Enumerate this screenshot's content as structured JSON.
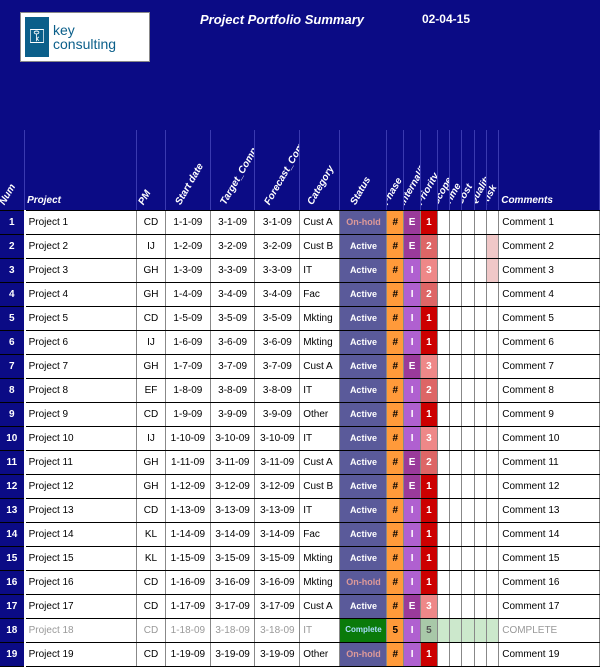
{
  "header": {
    "logo_text": "key\nconsulting",
    "title": "Project Portfolio Summary",
    "asof": "02-04-15"
  },
  "columns": [
    "Num",
    "Project",
    "PM",
    "Start date",
    "Target_Comp_Date",
    "Forecast_Comp_Date",
    "Category",
    "Status",
    "Phase",
    "Internal/Exter",
    "Priority",
    "Scope",
    "Time",
    "Cost",
    "Quality",
    "Risk",
    "Comments"
  ],
  "status_labels": {
    "Active": "Active",
    "Onhold": "On-hold",
    "Complete": "Complete"
  },
  "rows": [
    {
      "num": 1,
      "project": "Project 1",
      "pm": "CD",
      "start": "1-1-09",
      "target": "3-1-09",
      "forecast": "3-1-09",
      "cat": "Cust A",
      "status": "Onhold",
      "phase": "#",
      "ie": "E",
      "pri": 1,
      "mini": [
        "",
        "",
        "",
        "",
        ""
      ],
      "comment": "Comment 1"
    },
    {
      "num": 2,
      "project": "Project 2",
      "pm": "IJ",
      "start": "1-2-09",
      "target": "3-2-09",
      "forecast": "3-2-09",
      "cat": "Cust B",
      "status": "Active",
      "phase": "#",
      "ie": "E",
      "pri": 2,
      "mini": [
        "",
        "",
        "",
        "",
        "p"
      ],
      "comment": "Comment 2"
    },
    {
      "num": 3,
      "project": "Project 3",
      "pm": "GH",
      "start": "1-3-09",
      "target": "3-3-09",
      "forecast": "3-3-09",
      "cat": "IT",
      "status": "Active",
      "phase": "#",
      "ie": "I",
      "pri": 3,
      "mini": [
        "",
        "",
        "",
        "",
        "p"
      ],
      "comment": "Comment 3"
    },
    {
      "num": 4,
      "project": "Project 4",
      "pm": "GH",
      "start": "1-4-09",
      "target": "3-4-09",
      "forecast": "3-4-09",
      "cat": "Fac",
      "status": "Active",
      "phase": "#",
      "ie": "I",
      "pri": 2,
      "mini": [
        "",
        "",
        "",
        "",
        ""
      ],
      "comment": "Comment 4"
    },
    {
      "num": 5,
      "project": "Project 5",
      "pm": "CD",
      "start": "1-5-09",
      "target": "3-5-09",
      "forecast": "3-5-09",
      "cat": "Mkting",
      "status": "Active",
      "phase": "#",
      "ie": "I",
      "pri": 1,
      "mini": [
        "",
        "",
        "",
        "",
        ""
      ],
      "comment": "Comment 5"
    },
    {
      "num": 6,
      "project": "Project 6",
      "pm": "IJ",
      "start": "1-6-09",
      "target": "3-6-09",
      "forecast": "3-6-09",
      "cat": "Mkting",
      "status": "Active",
      "phase": "#",
      "ie": "I",
      "pri": 1,
      "mini": [
        "",
        "",
        "",
        "",
        ""
      ],
      "comment": "Comment 6"
    },
    {
      "num": 7,
      "project": "Project 7",
      "pm": "GH",
      "start": "1-7-09",
      "target": "3-7-09",
      "forecast": "3-7-09",
      "cat": "Cust A",
      "status": "Active",
      "phase": "#",
      "ie": "E",
      "pri": 3,
      "mini": [
        "",
        "",
        "",
        "",
        ""
      ],
      "comment": "Comment 7"
    },
    {
      "num": 8,
      "project": "Project 8",
      "pm": "EF",
      "start": "1-8-09",
      "target": "3-8-09",
      "forecast": "3-8-09",
      "cat": "IT",
      "status": "Active",
      "phase": "#",
      "ie": "I",
      "pri": 2,
      "mini": [
        "",
        "",
        "",
        "",
        ""
      ],
      "comment": "Comment 8"
    },
    {
      "num": 9,
      "project": "Project 9",
      "pm": "CD",
      "start": "1-9-09",
      "target": "3-9-09",
      "forecast": "3-9-09",
      "cat": "Other",
      "status": "Active",
      "phase": "#",
      "ie": "I",
      "pri": 1,
      "mini": [
        "",
        "",
        "",
        "",
        ""
      ],
      "comment": "Comment 9"
    },
    {
      "num": 10,
      "project": "Project 10",
      "pm": "IJ",
      "start": "1-10-09",
      "target": "3-10-09",
      "forecast": "3-10-09",
      "cat": "IT",
      "status": "Active",
      "phase": "#",
      "ie": "I",
      "pri": 3,
      "mini": [
        "",
        "",
        "",
        "",
        ""
      ],
      "comment": "Comment 10"
    },
    {
      "num": 11,
      "project": "Project 11",
      "pm": "GH",
      "start": "1-11-09",
      "target": "3-11-09",
      "forecast": "3-11-09",
      "cat": "Cust A",
      "status": "Active",
      "phase": "#",
      "ie": "E",
      "pri": 2,
      "mini": [
        "",
        "",
        "",
        "",
        ""
      ],
      "comment": "Comment 11"
    },
    {
      "num": 12,
      "project": "Project 12",
      "pm": "GH",
      "start": "1-12-09",
      "target": "3-12-09",
      "forecast": "3-12-09",
      "cat": "Cust B",
      "status": "Active",
      "phase": "#",
      "ie": "E",
      "pri": 1,
      "mini": [
        "",
        "",
        "",
        "",
        ""
      ],
      "comment": "Comment 12"
    },
    {
      "num": 13,
      "project": "Project 13",
      "pm": "CD",
      "start": "1-13-09",
      "target": "3-13-09",
      "forecast": "3-13-09",
      "cat": "IT",
      "status": "Active",
      "phase": "#",
      "ie": "I",
      "pri": 1,
      "mini": [
        "",
        "",
        "",
        "",
        ""
      ],
      "comment": "Comment 13"
    },
    {
      "num": 14,
      "project": "Project 14",
      "pm": "KL",
      "start": "1-14-09",
      "target": "3-14-09",
      "forecast": "3-14-09",
      "cat": "Fac",
      "status": "Active",
      "phase": "#",
      "ie": "I",
      "pri": 1,
      "mini": [
        "",
        "",
        "",
        "",
        ""
      ],
      "comment": "Comment 14"
    },
    {
      "num": 15,
      "project": "Project 15",
      "pm": "KL",
      "start": "1-15-09",
      "target": "3-15-09",
      "forecast": "3-15-09",
      "cat": "Mkting",
      "status": "Active",
      "phase": "#",
      "ie": "I",
      "pri": 1,
      "mini": [
        "",
        "",
        "",
        "",
        ""
      ],
      "comment": "Comment 15"
    },
    {
      "num": 16,
      "project": "Project 16",
      "pm": "CD",
      "start": "1-16-09",
      "target": "3-16-09",
      "forecast": "3-16-09",
      "cat": "Mkting",
      "status": "Onhold",
      "phase": "#",
      "ie": "I",
      "pri": 1,
      "mini": [
        "",
        "",
        "",
        "",
        ""
      ],
      "comment": "Comment 16"
    },
    {
      "num": 17,
      "project": "Project 17",
      "pm": "CD",
      "start": "1-17-09",
      "target": "3-17-09",
      "forecast": "3-17-09",
      "cat": "Cust A",
      "status": "Active",
      "phase": "#",
      "ie": "E",
      "pri": 3,
      "mini": [
        "",
        "",
        "",
        "",
        ""
      ],
      "comment": "Comment 17"
    },
    {
      "num": 18,
      "project": "Project 18",
      "pm": "CD",
      "start": "1-18-09",
      "target": "3-18-09",
      "forecast": "3-18-09",
      "cat": "IT",
      "status": "Complete",
      "phase": "5",
      "ie": "I",
      "pri": 5,
      "mini": [
        "g",
        "g",
        "g",
        "g",
        "g"
      ],
      "comment": "COMPLETE",
      "faded": true
    },
    {
      "num": 19,
      "project": "Project 19",
      "pm": "CD",
      "start": "1-19-09",
      "target": "3-19-09",
      "forecast": "3-19-09",
      "cat": "Other",
      "status": "Onhold",
      "phase": "#",
      "ie": "I",
      "pri": 1,
      "mini": [
        "",
        "",
        "",
        "",
        ""
      ],
      "comment": "Comment 19"
    }
  ]
}
